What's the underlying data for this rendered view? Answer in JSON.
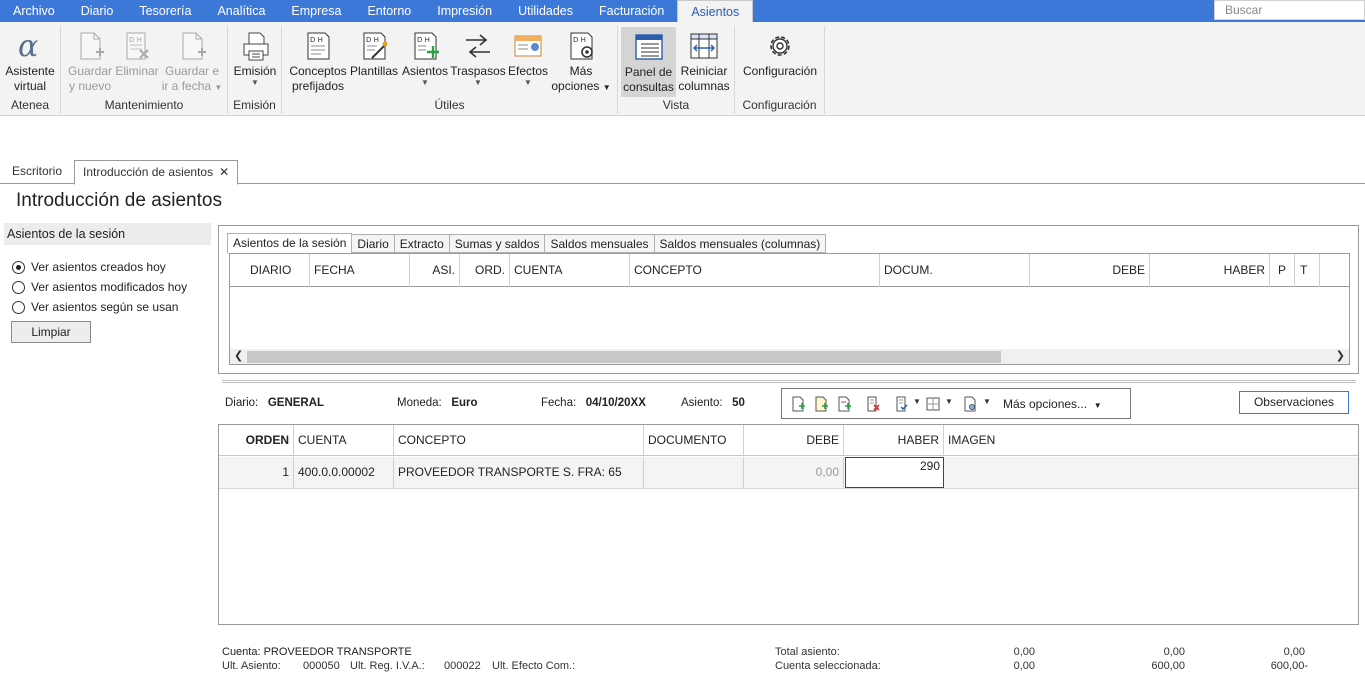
{
  "menu": {
    "items": [
      "Archivo",
      "Diario",
      "Tesorería",
      "Analítica",
      "Empresa",
      "Entorno",
      "Impresión",
      "Utilidades",
      "Facturación",
      "Asientos"
    ],
    "active": "Asientos",
    "search_placeholder": "Buscar"
  },
  "ribbon": {
    "atenea": {
      "title": "Atenea",
      "asistente_1": "Asistente",
      "asistente_2": "virtual"
    },
    "mantenimiento": {
      "title": "Mantenimiento",
      "guardar_1": "Guardar",
      "guardar_2": "y nuevo",
      "eliminar": "Eliminar",
      "guardarir_1": "Guardar e",
      "guardarir_2": "ir a fecha"
    },
    "emision": {
      "title": "Emisión",
      "emision": "Emisión"
    },
    "utiles": {
      "title": "Útiles",
      "conceptos_1": "Conceptos",
      "conceptos_2": "prefijados",
      "plantillas": "Plantillas",
      "asientos": "Asientos",
      "traspasos": "Traspasos",
      "efectos": "Efectos",
      "mas_1": "Más",
      "mas_2": "opciones"
    },
    "vista": {
      "title": "Vista",
      "panel_1": "Panel de",
      "panel_2": "consultas",
      "reiniciar_1": "Reiniciar",
      "reiniciar_2": "columnas"
    },
    "configuracion": {
      "title": "Configuración",
      "configuracion": "Configuración"
    }
  },
  "doc_tabs": {
    "escritorio": "Escritorio",
    "introduccion": "Introducción de asientos"
  },
  "page_title": "Introducción de asientos",
  "left_panel": {
    "header": "Asientos de la sesión",
    "options": [
      "Ver asientos creados hoy",
      "Ver asientos modificados hoy",
      "Ver asientos según se usan"
    ],
    "selected_index": 0,
    "limpiar": "Limpiar"
  },
  "session_tabs": [
    "Asientos de la sesión",
    "Diario",
    "Extracto",
    "Sumas y saldos",
    "Saldos mensuales",
    "Saldos mensuales (columnas)"
  ],
  "session_columns": [
    "DIARIO",
    "FECHA",
    "ASI.",
    "ORD.",
    "CUENTA",
    "CONCEPTO",
    "DOCUM.",
    "DEBE",
    "HABER",
    "P",
    "T"
  ],
  "info": {
    "diario_label": "Diario:",
    "diario": "GENERAL",
    "moneda_label": "Moneda:",
    "moneda": "Euro",
    "fecha_label": "Fecha:",
    "fecha": "04/10/20XX",
    "asiento_label": "Asiento:",
    "asiento": "50",
    "mas_opciones": "Más opciones...",
    "observaciones": "Observaciones"
  },
  "entry_columns": [
    "ORDEN",
    "CUENTA",
    "CONCEPTO",
    "DOCUMENTO",
    "DEBE",
    "HABER",
    "IMAGEN"
  ],
  "entry_row": {
    "orden": "1",
    "cuenta": "400.0.0.00002",
    "concepto": "PROVEEDOR TRANSPORTE S. FRA:  65",
    "documento": "",
    "debe": "0,00",
    "haber": "290"
  },
  "footer": {
    "cuenta_label": "Cuenta:",
    "cuenta": "PROVEEDOR TRANSPORTE",
    "ult_asiento_label": "Ult. Asiento:",
    "ult_asiento": "000050",
    "ult_reg_label": "Ult. Reg. I.V.A.:",
    "ult_reg": "000022",
    "ult_efecto_label": "Ult. Efecto Com.:",
    "total_label": "Total asiento:",
    "total_debe": "0,00",
    "total_haber": "0,00",
    "total_saldo": "0,00",
    "sel_label": "Cuenta seleccionada:",
    "sel_debe": "0,00",
    "sel_haber": "600,00",
    "sel_saldo": "600,00-"
  },
  "colors": {
    "menubar": "#3c78d8",
    "ribbon": "#f3f3f3"
  }
}
